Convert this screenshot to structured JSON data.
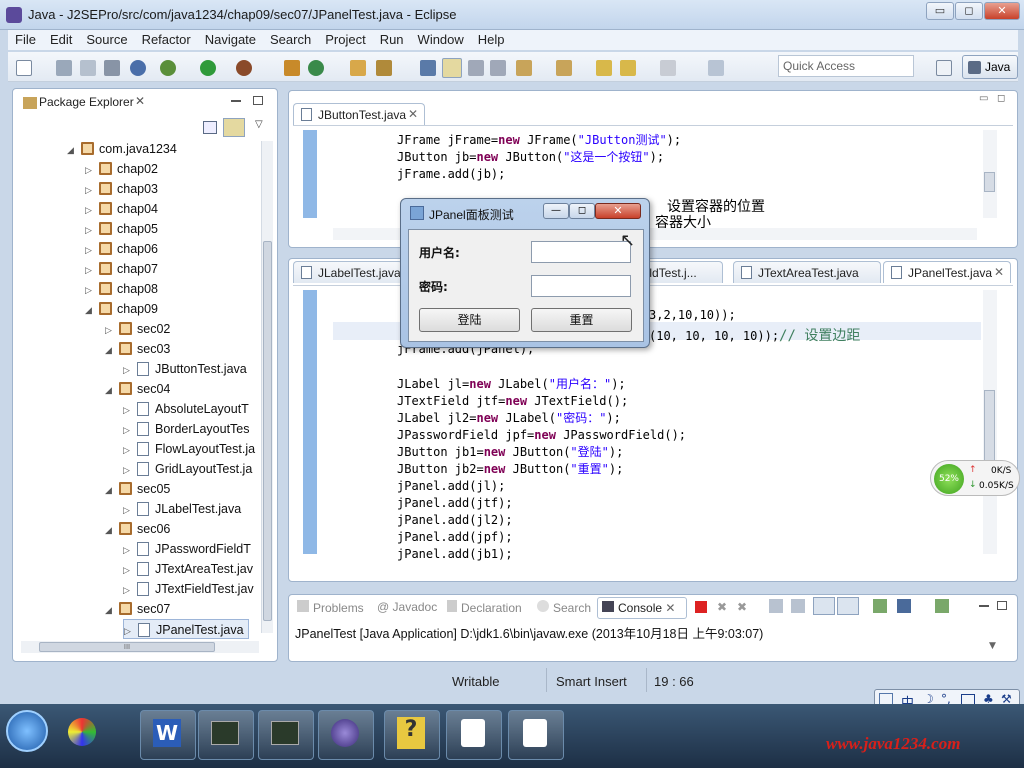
{
  "window": {
    "title": "Java - J2SEPro/src/com/java1234/chap09/sec07/JPanelTest.java - Eclipse",
    "minimize_glyph": "▭",
    "maximize_glyph": "◻",
    "close_glyph": "✕"
  },
  "menu": [
    "File",
    "Edit",
    "Source",
    "Refactor",
    "Navigate",
    "Search",
    "Project",
    "Run",
    "Window",
    "Help"
  ],
  "toolbar": {
    "quick_access_placeholder": "Quick Access",
    "perspective_label": "Java"
  },
  "package_explorer": {
    "title": "Package Explorer",
    "items": [
      {
        "label": "com.java1234",
        "kind": "package",
        "indent": 0,
        "twisty": "◢"
      },
      {
        "label": "chap02",
        "kind": "package",
        "indent": 1,
        "twisty": "▷"
      },
      {
        "label": "chap03",
        "kind": "package",
        "indent": 1,
        "twisty": "▷"
      },
      {
        "label": "chap04",
        "kind": "package",
        "indent": 1,
        "twisty": "▷"
      },
      {
        "label": "chap05",
        "kind": "package",
        "indent": 1,
        "twisty": "▷"
      },
      {
        "label": "chap06",
        "kind": "package",
        "indent": 1,
        "twisty": "▷"
      },
      {
        "label": "chap07",
        "kind": "package",
        "indent": 1,
        "twisty": "▷"
      },
      {
        "label": "chap08",
        "kind": "package",
        "indent": 1,
        "twisty": "▷"
      },
      {
        "label": "chap09",
        "kind": "package",
        "indent": 1,
        "twisty": "◢"
      },
      {
        "label": "sec02",
        "kind": "package",
        "indent": 2,
        "twisty": "▷"
      },
      {
        "label": "sec03",
        "kind": "package",
        "indent": 2,
        "twisty": "◢"
      },
      {
        "label": "JButtonTest.java",
        "kind": "java",
        "indent": 3,
        "twisty": "▷"
      },
      {
        "label": "sec04",
        "kind": "package",
        "indent": 2,
        "twisty": "◢"
      },
      {
        "label": "AbsoluteLayoutT",
        "kind": "java",
        "indent": 3,
        "twisty": "▷"
      },
      {
        "label": "BorderLayoutTes",
        "kind": "java",
        "indent": 3,
        "twisty": "▷"
      },
      {
        "label": "FlowLayoutTest.ja",
        "kind": "java",
        "indent": 3,
        "twisty": "▷"
      },
      {
        "label": "GridLayoutTest.ja",
        "kind": "java",
        "indent": 3,
        "twisty": "▷"
      },
      {
        "label": "sec05",
        "kind": "package",
        "indent": 2,
        "twisty": "◢"
      },
      {
        "label": "JLabelTest.java",
        "kind": "java",
        "indent": 3,
        "twisty": "▷"
      },
      {
        "label": "sec06",
        "kind": "package",
        "indent": 2,
        "twisty": "◢"
      },
      {
        "label": "JPasswordFieldT",
        "kind": "java",
        "indent": 3,
        "twisty": "▷"
      },
      {
        "label": "JTextAreaTest.jav",
        "kind": "java",
        "indent": 3,
        "twisty": "▷"
      },
      {
        "label": "JTextFieldTest.jav",
        "kind": "java",
        "indent": 3,
        "twisty": "▷"
      },
      {
        "label": "sec07",
        "kind": "package",
        "indent": 2,
        "twisty": "◢"
      },
      {
        "label": "JPanelTest.java",
        "kind": "java",
        "indent": 3,
        "twisty": "▷",
        "selected": true
      }
    ],
    "hscroll_glyph": "III"
  },
  "editor_top": {
    "tab": "JButtonTest.java",
    "lines": [
      [
        {
          "t": "JFrame jFrame=",
          "c": ""
        },
        {
          "t": "new",
          "c": "kw"
        },
        {
          "t": " JFrame(",
          "c": ""
        },
        {
          "t": "\"JButton测试\"",
          "c": "str"
        },
        {
          "t": ");",
          "c": ""
        }
      ],
      [
        {
          "t": "JButton jb=",
          "c": ""
        },
        {
          "t": "new",
          "c": "kw"
        },
        {
          "t": " JButton(",
          "c": ""
        },
        {
          "t": "\"这是一个按钮\"",
          "c": "str"
        },
        {
          "t": ");",
          "c": ""
        }
      ],
      [
        {
          "t": "jFrame.add(jb);",
          "c": ""
        }
      ]
    ],
    "visible_comment_1": "设置容器的位置",
    "visible_comment_2": "容器大小"
  },
  "editor_bottom": {
    "tabs": [
      "JLabelTest.java",
      "ieldTest.j...",
      "JTextAreaTest.java",
      "JPanelTest.java"
    ],
    "active_tab": "JPanelTest.java",
    "partial_line_1": "3,2,10,10));",
    "partial_line_2_code": "(10, 10, 10, 10));",
    "partial_line_2_comment": "// 设置边距",
    "partial_line_3": "jFrame.add(jPanel);",
    "lines": [
      [
        {
          "t": "JLabel jl=",
          "c": ""
        },
        {
          "t": "new",
          "c": "kw"
        },
        {
          "t": " JLabel(",
          "c": ""
        },
        {
          "t": "\"用户名：\"",
          "c": "str"
        },
        {
          "t": ");",
          "c": ""
        }
      ],
      [
        {
          "t": "JTextField jtf=",
          "c": ""
        },
        {
          "t": "new",
          "c": "kw"
        },
        {
          "t": " JTextField();",
          "c": ""
        }
      ],
      [
        {
          "t": "JLabel jl2=",
          "c": ""
        },
        {
          "t": "new",
          "c": "kw"
        },
        {
          "t": " JLabel(",
          "c": ""
        },
        {
          "t": "\"密码：\"",
          "c": "str"
        },
        {
          "t": ");",
          "c": ""
        }
      ],
      [
        {
          "t": "JPasswordField jpf=",
          "c": ""
        },
        {
          "t": "new",
          "c": "kw"
        },
        {
          "t": " JPasswordField();",
          "c": ""
        }
      ],
      [
        {
          "t": "JButton jb1=",
          "c": ""
        },
        {
          "t": "new",
          "c": "kw"
        },
        {
          "t": " JButton(",
          "c": ""
        },
        {
          "t": "\"登陆\"",
          "c": "str"
        },
        {
          "t": ");",
          "c": ""
        }
      ],
      [
        {
          "t": "JButton jb2=",
          "c": ""
        },
        {
          "t": "new",
          "c": "kw"
        },
        {
          "t": " JButton(",
          "c": ""
        },
        {
          "t": "\"重置\"",
          "c": "str"
        },
        {
          "t": ");",
          "c": ""
        }
      ],
      [
        {
          "t": "jPanel.add(jl);",
          "c": ""
        }
      ],
      [
        {
          "t": "jPanel.add(jtf);",
          "c": ""
        }
      ],
      [
        {
          "t": "jPanel.add(jl2);",
          "c": ""
        }
      ],
      [
        {
          "t": "jPanel.add(jpf);",
          "c": ""
        }
      ],
      [
        {
          "t": "jPanel.add(jb1);",
          "c": ""
        }
      ]
    ]
  },
  "dialog": {
    "title": "JPanel面板测试",
    "username_label": "用户名:",
    "password_label": "密码:",
    "login_button": "登陆",
    "reset_button": "重置"
  },
  "console": {
    "tabs": [
      "Problems",
      "Javadoc",
      "Declaration",
      "Search",
      "Console"
    ],
    "active_tab": "Console",
    "output": "JPanelTest [Java Application] D:\\jdk1.6\\bin\\javaw.exe (2013年10月18日 上午9:03:07)"
  },
  "status_bar": {
    "writable": "Writable",
    "insert_mode": "Smart Insert",
    "position": "19 : 66"
  },
  "network_widget": {
    "percent": "52%",
    "up": "0K/S",
    "down": "0.05K/S"
  },
  "ime_bar": {
    "lang": "中"
  },
  "watermark": "www.java1234.com",
  "colors": {
    "keyword": "#7f0055",
    "string": "#2a00ff",
    "comment": "#3f7f5f",
    "title_bar": "#c2d5ec",
    "taskbar": "#1d2f45"
  }
}
